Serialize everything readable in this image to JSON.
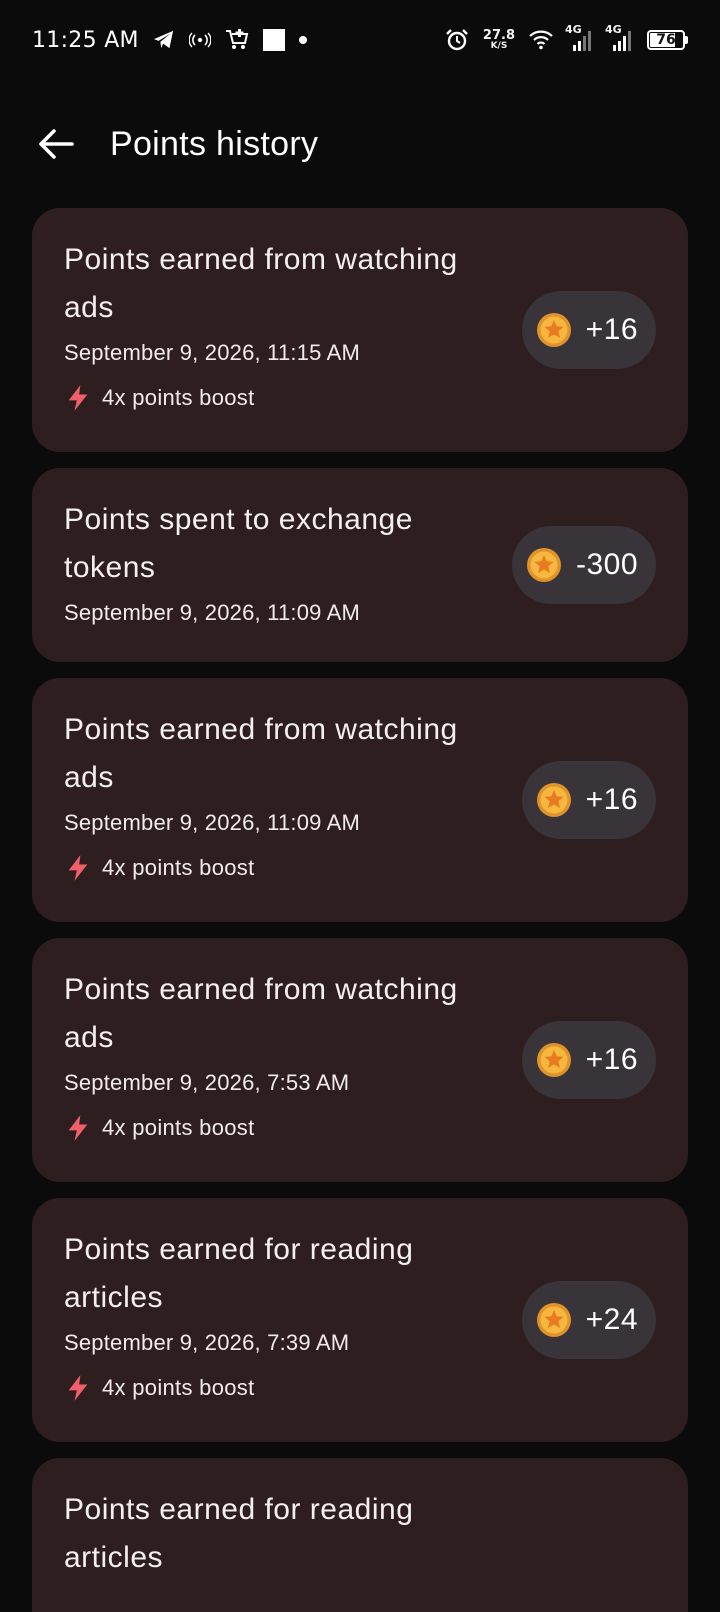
{
  "status_bar": {
    "time": "11:25 AM",
    "net_speed_value": "27.8",
    "net_speed_unit": "K/S",
    "network_1": "4G",
    "network_2": "4G",
    "battery": "76",
    "icons": [
      "telegram-icon",
      "hotspot-icon",
      "cart-icon",
      "square-icon",
      "dot-icon",
      "alarm-icon",
      "wifi-icon",
      "signal-icon",
      "battery-icon"
    ]
  },
  "app_bar": {
    "back_icon": "arrow-back-icon",
    "title": "Points history"
  },
  "colors": {
    "background": "#0b0b0c",
    "card": "#2f1e20",
    "pill": "#38343a",
    "boost_icon": "#f0606a",
    "coin": "#f3b33c"
  },
  "entries": [
    {
      "title": "Points earned from watching ads",
      "date": "September 9, 2026, 11:15 AM",
      "boost": "4x points boost",
      "points": "+16"
    },
    {
      "title": "Points spent to exchange tokens",
      "date": "September 9, 2026, 11:09 AM",
      "boost": "",
      "points": "-300"
    },
    {
      "title": "Points earned from watching ads",
      "date": "September 9, 2026, 11:09 AM",
      "boost": "4x points boost",
      "points": "+16"
    },
    {
      "title": "Points earned from watching ads",
      "date": "September 9, 2026, 7:53 AM",
      "boost": "4x points boost",
      "points": "+16"
    },
    {
      "title": "Points earned for reading articles",
      "date": "September 9, 2026, 7:39 AM",
      "boost": "4x points boost",
      "points": "+24"
    },
    {
      "title": "Points earned for reading articles",
      "date": "",
      "boost": "",
      "points": ""
    }
  ]
}
